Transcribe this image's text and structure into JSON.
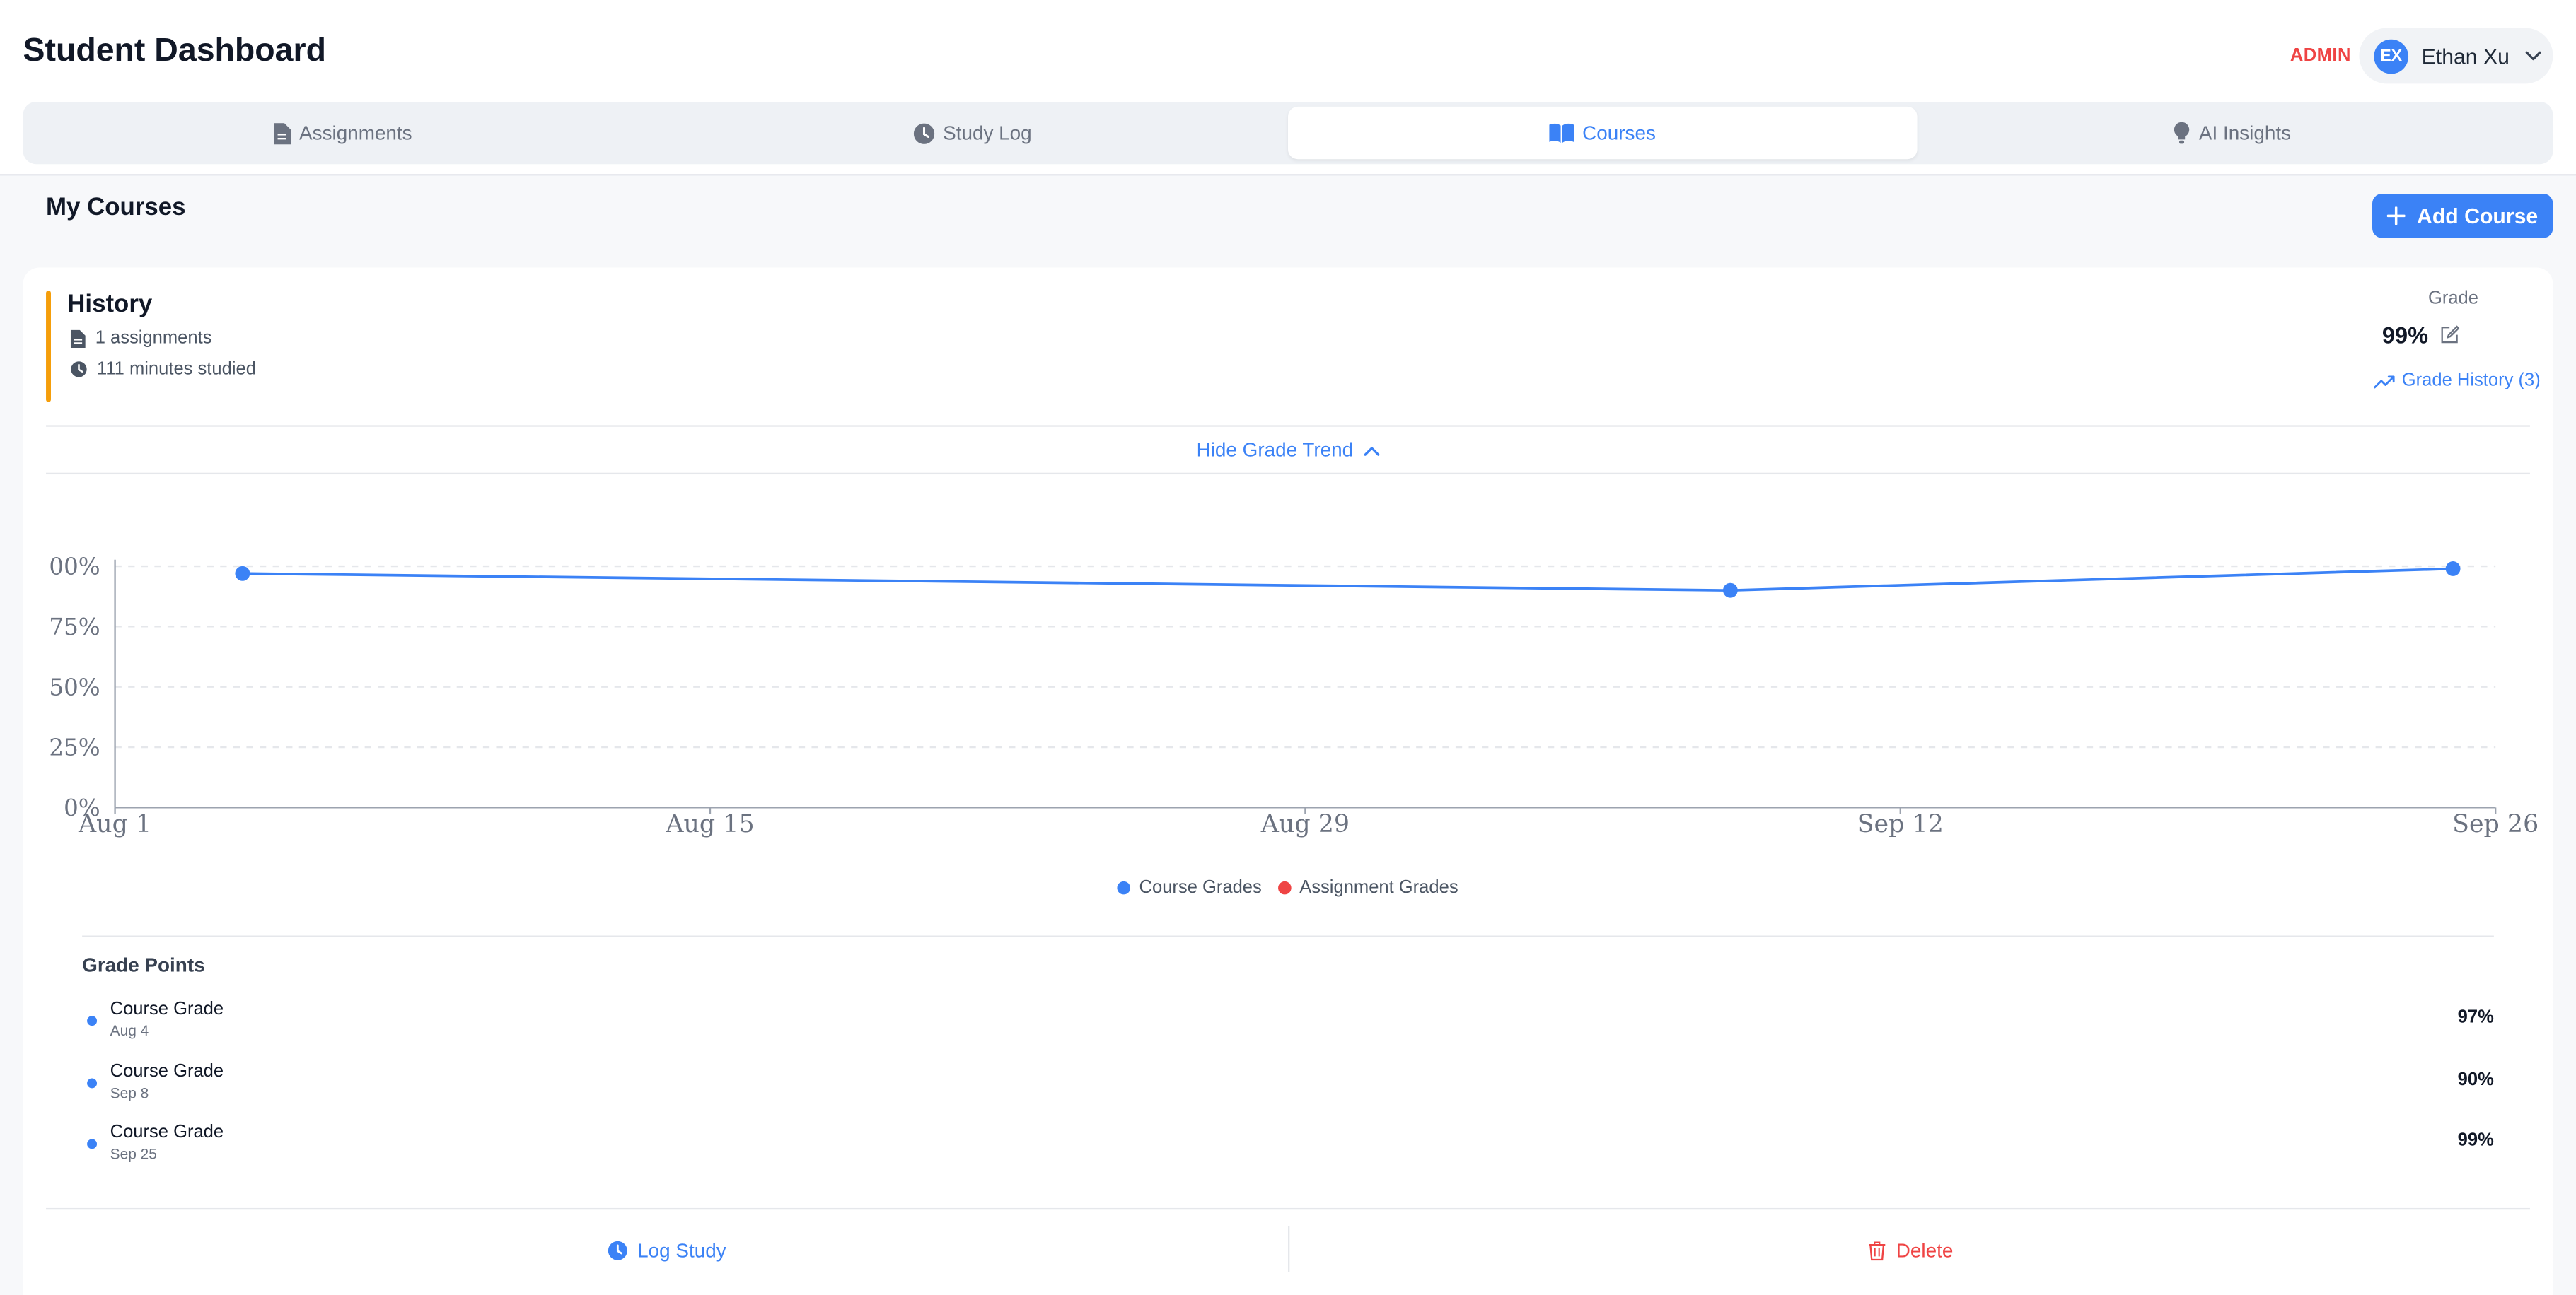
{
  "app": {
    "title": "Student Dashboard",
    "role_badge": "ADMIN"
  },
  "user": {
    "initials": "EX",
    "name": "Ethan Xu"
  },
  "tabs": [
    {
      "label": "Assignments",
      "icon": "document-icon",
      "active": false
    },
    {
      "label": "Study Log",
      "icon": "clock-icon",
      "active": false
    },
    {
      "label": "Courses",
      "icon": "book-icon",
      "active": true
    },
    {
      "label": "AI Insights",
      "icon": "lightbulb-icon",
      "active": false
    }
  ],
  "page": {
    "title": "My Courses",
    "add_button": "Add Course"
  },
  "course": {
    "name": "History",
    "accent_color": "#f59e0b",
    "assignments_text": "1 assignments",
    "study_text": "111 minutes studied",
    "grade_label": "Grade",
    "grade_value": "99%",
    "grade_history_link": "Grade History (3)",
    "toggle_trend": "Hide Grade Trend"
  },
  "chart_data": {
    "type": "line",
    "y_tick_labels": [
      "00%",
      "75%",
      "50%",
      "25%",
      "0%"
    ],
    "x_tick_labels": [
      "Aug 1",
      "Aug 15",
      "Aug 29",
      "Sep 12",
      "Sep 26"
    ],
    "ylim": [
      0,
      100
    ],
    "grid": true,
    "series": [
      {
        "name": "Course Grades",
        "color": "#3b82f6",
        "points": [
          {
            "x": "Aug 4",
            "y": 97
          },
          {
            "x": "Sep 8",
            "y": 90
          },
          {
            "x": "Sep 25",
            "y": 99
          }
        ]
      },
      {
        "name": "Assignment Grades",
        "color": "#ef4444",
        "points": []
      }
    ],
    "legend_position": "bottom"
  },
  "grade_points": {
    "title": "Grade Points",
    "items": [
      {
        "name": "Course Grade",
        "date": "Aug 4",
        "value": "97%"
      },
      {
        "name": "Course Grade",
        "date": "Sep 8",
        "value": "90%"
      },
      {
        "name": "Course Grade",
        "date": "Sep 25",
        "value": "99%"
      }
    ]
  },
  "actions": {
    "log_study": "Log Study",
    "delete": "Delete"
  },
  "colors": {
    "primary": "#3b82f6",
    "danger": "#ef4444",
    "accent": "#f59e0b"
  }
}
